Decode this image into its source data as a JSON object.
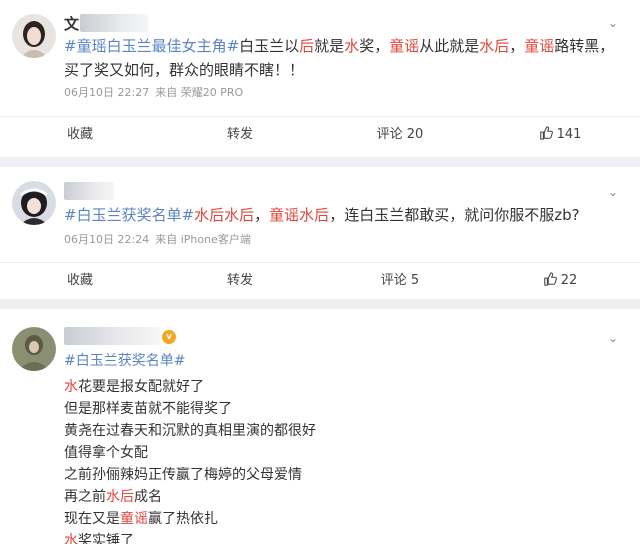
{
  "posts": [
    {
      "name_visible": "文",
      "text": {
        "topic1": "#童瑶白玉兰最佳女主角#",
        "p1": "白玉兰以",
        "hl1": "后",
        "p2": "就是",
        "hl2": "水",
        "p3": "奖，",
        "hl3": "童谣",
        "p4": "从此就是",
        "hl4": "水后",
        "p5": "，",
        "hl5": "童谣",
        "p6": "路转黑，买了奖又如何，群众的眼睛不瞎！！"
      },
      "date": "06月10日 22:27",
      "source": "来自 荣耀20 PRO",
      "actions": {
        "collect": "收藏",
        "repost": "转发",
        "comment": "评论 20",
        "like": "141"
      }
    },
    {
      "text": {
        "topic1": "#白玉兰获奖名单#",
        "hl1": "水后水后",
        "p1": "，",
        "hl2": "童谣水后",
        "p2": "，连白玉兰都敢买，就问你服不服zb?"
      },
      "date": "06月10日 22:24",
      "source": "来自 iPhone客户端",
      "actions": {
        "collect": "收藏",
        "repost": "转发",
        "comment": "评论 5",
        "like": "22"
      }
    },
    {
      "topic": "#白玉兰获奖名单#",
      "lines": [
        {
          "hl": "水",
          "rest": "花要是报女配就好了"
        },
        {
          "hl": "",
          "rest": "但是那样麦苗就不能得奖了"
        },
        {
          "hl": "",
          "rest": "黄尧在过春天和沉默的真相里演的都很好"
        },
        {
          "hl": "",
          "rest": "值得拿个女配"
        },
        {
          "hl": "",
          "rest": "之前孙俪辣妈正传赢了梅婷的父母爱情"
        },
        {
          "pre": "再之前",
          "hl": "水后",
          "rest": "成名"
        },
        {
          "pre": "现在又是",
          "hl": "童谣",
          "rest": "赢了热依扎"
        },
        {
          "hl": "水",
          "rest": "奖实锤了"
        }
      ]
    }
  ],
  "colors": {
    "topic": "#5a84c4",
    "highlight": "#e0463c",
    "meta": "#999999"
  }
}
